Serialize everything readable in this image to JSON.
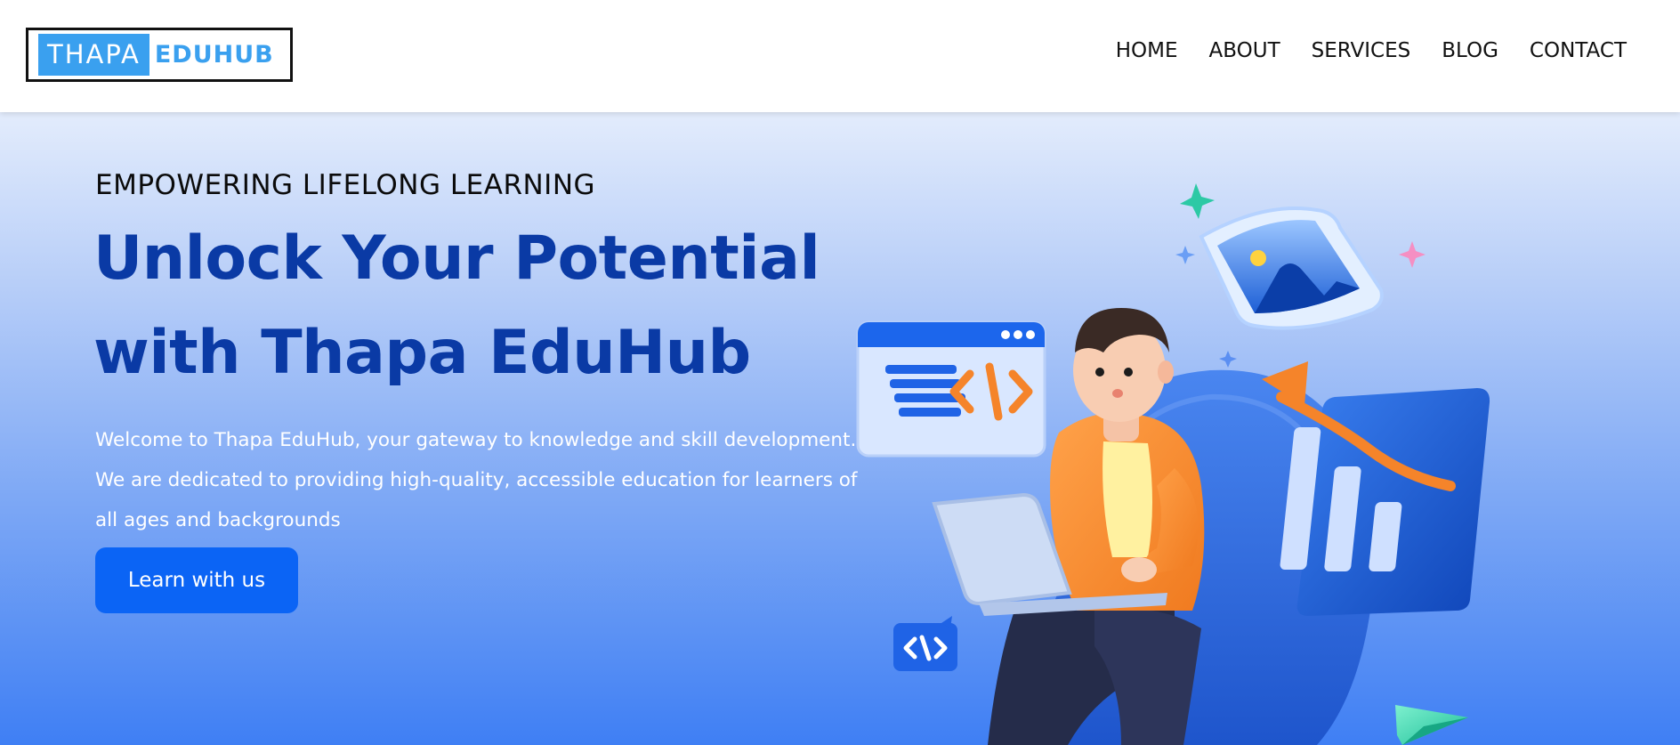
{
  "logo": {
    "part1": "THAPA",
    "part2": "EDUHUB"
  },
  "nav": {
    "items": [
      {
        "label": "HOME"
      },
      {
        "label": "ABOUT"
      },
      {
        "label": "SERVICES"
      },
      {
        "label": "BLOG"
      },
      {
        "label": "CONTACT"
      }
    ]
  },
  "hero": {
    "eyebrow": "EMPOWERING LIFELONG LEARNING",
    "headline_line1": "Unlock Your Potential",
    "headline_line2": "with Thapa EduHub",
    "description": "Welcome to Thapa EduHub, your gateway to knowledge and skill development. We are dedicated to providing high-quality, accessible education for learners of all ages and backgrounds",
    "cta_label": "Learn with us"
  },
  "illustration": {
    "code_symbol": "<\\>",
    "small_code_symbol": "<\\>"
  },
  "colors": {
    "brand_blue": "#3aa0ef",
    "headline_blue": "#0a3aa5",
    "button_blue": "#0b64f5",
    "gradient_top": "#e3ecfc",
    "gradient_bottom": "#3f7ff4"
  }
}
